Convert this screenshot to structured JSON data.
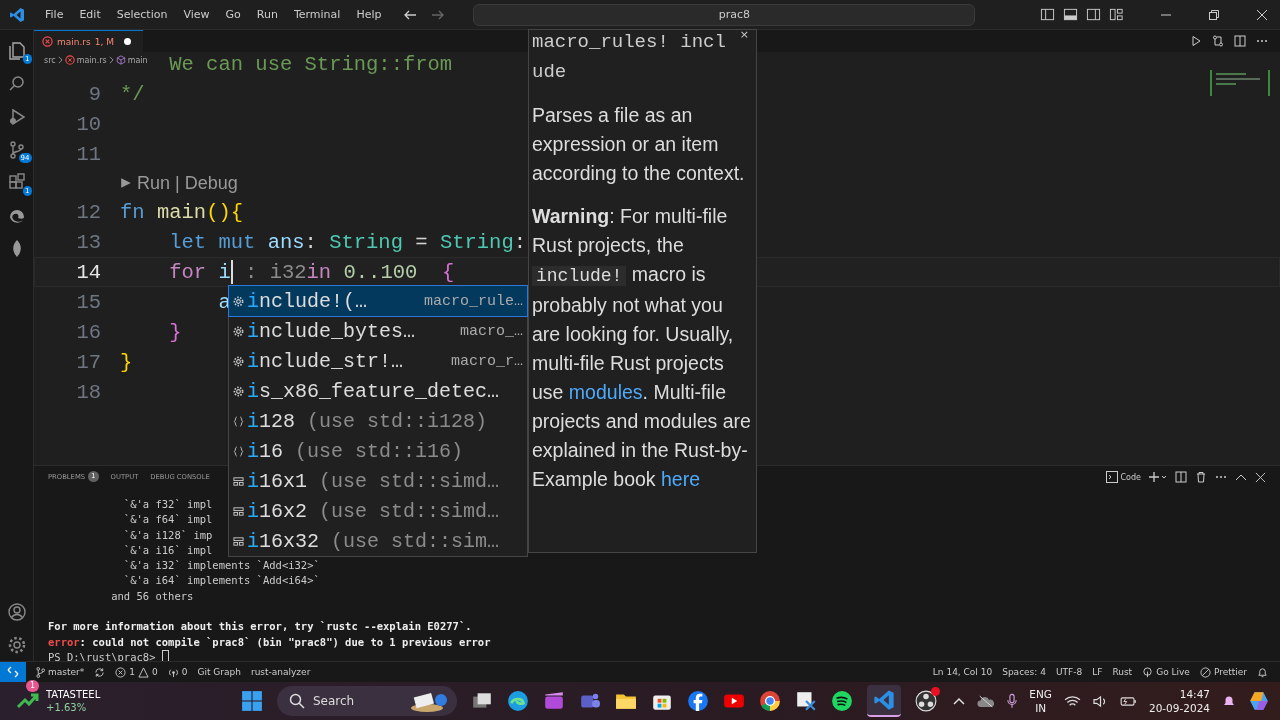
{
  "menu": [
    "File",
    "Edit",
    "Selection",
    "View",
    "Go",
    "Run",
    "Terminal",
    "Help"
  ],
  "command_center": {
    "text": "prac8"
  },
  "activity_bar": {
    "badges": [
      {
        "text": "1"
      },
      {
        "text": "94"
      },
      {
        "text": "1"
      }
    ]
  },
  "editor_tab": {
    "name": "main.rs",
    "status": "1, M",
    "dirty": true
  },
  "breadcrumb": [
    "src",
    "main.rs",
    "main"
  ],
  "code_lines": [
    {
      "tokens": [
        {
          "kind": "comment",
          "text": "    We can use String::from"
        }
      ]
    },
    {
      "number": "9",
      "current": false,
      "tokens": [
        {
          "kind": "comment",
          "text": "*/"
        }
      ]
    },
    {
      "number": "10",
      "current": false
    },
    {
      "number": "11",
      "current": false
    },
    {
      "number": "12",
      "current": false,
      "codelens": {
        "actions": [
          "Run",
          "Debug"
        ],
        "separator": "|"
      },
      "tokens": [
        {
          "kind": "keyword",
          "text": "fn "
        },
        {
          "kind": "function",
          "text": "main"
        },
        {
          "kind": "bracket",
          "text": "(){"
        }
      ]
    },
    {
      "number": "13",
      "current": false,
      "tokens": [
        {
          "kind": "keyword",
          "text": "    let mut "
        },
        {
          "kind": "variable",
          "text": "ans"
        },
        {
          "kind": "plain",
          "text": ": "
        },
        {
          "kind": "type",
          "text": "String"
        },
        {
          "kind": "plain",
          "text": " = "
        },
        {
          "kind": "type",
          "text": "String"
        },
        {
          "kind": "plain",
          "text": ":"
        }
      ]
    },
    {
      "number": "14",
      "current": true,
      "tokens": [
        {
          "kind": "control",
          "text": "    for "
        },
        {
          "kind": "variable",
          "text": "i"
        },
        {
          "kind": "cursor"
        },
        {
          "kind": "hint",
          "text": " : i32"
        },
        {
          "kind": "control",
          "text": "in"
        },
        {
          "kind": "number",
          "text": " 0..100  "
        },
        {
          "kind": "bracket2",
          "text": "{"
        }
      ]
    },
    {
      "number": "15",
      "current": false,
      "tokens": [
        {
          "kind": "variable",
          "text": "        a"
        }
      ]
    },
    {
      "number": "16",
      "current": false,
      "tokens": [
        {
          "kind": "bracket2",
          "text": "    }"
        }
      ]
    },
    {
      "number": "17",
      "current": false,
      "tokens": [
        {
          "kind": "bracket",
          "text": "}"
        }
      ]
    },
    {
      "number": "18",
      "current": false
    }
  ],
  "suggestions": [
    {
      "kind": "macro",
      "label": "include!(…",
      "detail": "macro_rule…",
      "selected": true
    },
    {
      "kind": "macro",
      "label": "include_bytes…",
      "detail": "macro_…",
      "selected": false
    },
    {
      "kind": "macro",
      "label": "include_str!…",
      "detail": "macro_r…",
      "selected": false
    },
    {
      "kind": "macro",
      "label": "is_x86_feature_detec…",
      "selected": false
    },
    {
      "kind": "module",
      "label": "i128",
      "detail": "(use std::i128)",
      "selected": false
    },
    {
      "kind": "module",
      "label": "i16",
      "detail": "(use std::i16)",
      "selected": false
    },
    {
      "kind": "struct",
      "label": "i16x1",
      "detail": "(use std::simd…",
      "selected": false
    },
    {
      "kind": "struct",
      "label": "i16x2",
      "detail": "(use std::simd…",
      "selected": false
    },
    {
      "kind": "struct",
      "label": "i16x32",
      "detail": "(use std::sim…",
      "selected": false
    }
  ],
  "hover": {
    "title": "macro_rules! include",
    "close": "×",
    "paragraphs": [
      [
        {
          "kind": "text",
          "text": "Parses a file as an expression or an item according to the context."
        }
      ],
      [
        {
          "kind": "bold",
          "text": "Warning"
        },
        {
          "kind": "text",
          "text": ": For multi-file Rust projects, the "
        },
        {
          "kind": "code",
          "text": "include!"
        },
        {
          "kind": "text",
          "text": " macro is probably not what you are looking for. Usually, multi-file Rust projects use "
        },
        {
          "kind": "link",
          "text": "modules"
        },
        {
          "kind": "text",
          "text": ". Multi-file projects and modules are explained in the Rust-by-Example book "
        },
        {
          "kind": "link",
          "text": "here"
        }
      ]
    ]
  },
  "panel": {
    "tabs": [
      {
        "label": "PROBLEMS",
        "badge": "1",
        "selected": false
      },
      {
        "label": "OUTPUT",
        "selected": false
      },
      {
        "label": "DEBUG CONSOLE",
        "selected": false
      }
    ],
    "terminal_name": "Code",
    "lines": [
      {
        "kind": "normal",
        "text": "            `&'a f32` impl"
      },
      {
        "kind": "normal",
        "text": "            `&'a f64` impl"
      },
      {
        "kind": "normal",
        "text": "            `&'a i128` imp"
      },
      {
        "kind": "normal",
        "text": "            `&'a i16` impl"
      },
      {
        "kind": "normal",
        "text": "            `&'a i32` implements `Add<i32>`"
      },
      {
        "kind": "normal",
        "text": "            `&'a i64` implements `Add<i64>`"
      },
      {
        "kind": "normal",
        "text": "          and 56 others"
      },
      {
        "kind": "blank"
      },
      {
        "kind": "bold",
        "text": "For more information about this error, try `rustc --explain E0277`."
      },
      {
        "kind": "error",
        "label": "error",
        "text": ": could not compile `prac8` (bin \"prac8\") due to 1 previous error"
      },
      {
        "kind": "prompt",
        "text": "PS D:\\rust\\prac8> "
      }
    ]
  },
  "status_bar": {
    "branch": "master*",
    "errors": "1",
    "warnings": "0",
    "ports": "0",
    "left": [
      "Git Graph",
      "rust-analyzer"
    ],
    "right": [
      "Ln 14, Col 10",
      "Spaces: 4",
      "UTF-8",
      "LF",
      "Rust"
    ],
    "go_live": "Go Live",
    "prettier": "Prettier"
  },
  "taskbar": {
    "stock": {
      "name": "TATASTEEL",
      "change": "+1.63%",
      "badge": "1"
    },
    "search": {
      "placeholder": "Search"
    },
    "language": [
      "ENG",
      "IN"
    ],
    "time": "14:47",
    "date": "20-09-2024"
  }
}
